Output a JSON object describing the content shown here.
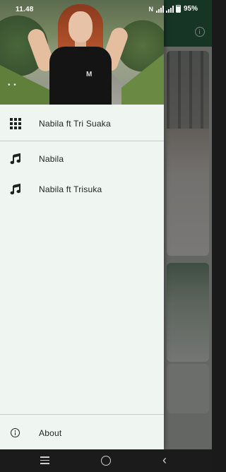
{
  "status_bar": {
    "time": "11.48",
    "battery": "95%",
    "icons": [
      "nfc-icon",
      "signal-icon",
      "signal-icon",
      "battery-icon"
    ]
  },
  "background_app": {
    "toolbar_icon": "info-icon"
  },
  "drawer": {
    "header_image": "woman-in-black-tshirt-photo",
    "items": [
      {
        "label": "Nabila ft Tri Suaka",
        "icon": "grid-icon"
      },
      {
        "label": "Nabila",
        "icon": "music-note-icon"
      },
      {
        "label": "Nabila ft Trisuka",
        "icon": "music-note-icon"
      }
    ],
    "footer_item": {
      "label": "About",
      "icon": "info-icon"
    }
  },
  "nav_bar": {
    "buttons": [
      "recents-icon",
      "home-icon",
      "back-icon"
    ]
  },
  "colors": {
    "drawer_bg": "#eff5f1",
    "app_bar": "#2e6b4a",
    "text": "#1d2420",
    "nav_bar": "#1b1b1b"
  }
}
